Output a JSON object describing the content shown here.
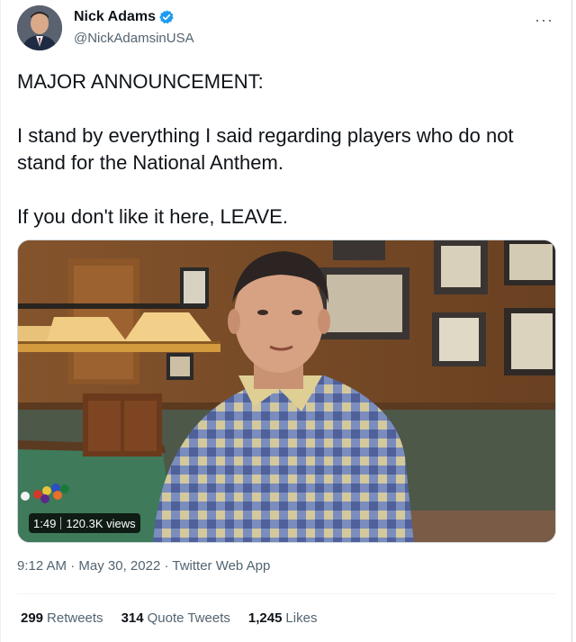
{
  "author": {
    "name": "Nick Adams",
    "handle": "@NickAdamsinUSA",
    "verified_color": "#1d9bf0"
  },
  "more_label": "···",
  "tweet": {
    "paragraphs": [
      "MAJOR ANNOUNCEMENT:",
      "I stand by everything I said regarding players who do not stand for the National Anthem.",
      "If you don't like it here, LEAVE."
    ]
  },
  "media": {
    "duration": "1:49",
    "views": "120.3K views"
  },
  "meta": {
    "time": "9:12 AM",
    "sep1": " · ",
    "date": "May 30, 2022",
    "sep2": " · ",
    "source": "Twitter Web App"
  },
  "stats": {
    "retweets_count": "299",
    "retweets_label": "Retweets",
    "quotes_count": "314",
    "quotes_label": "Quote Tweets",
    "likes_count": "1,245",
    "likes_label": "Likes"
  }
}
